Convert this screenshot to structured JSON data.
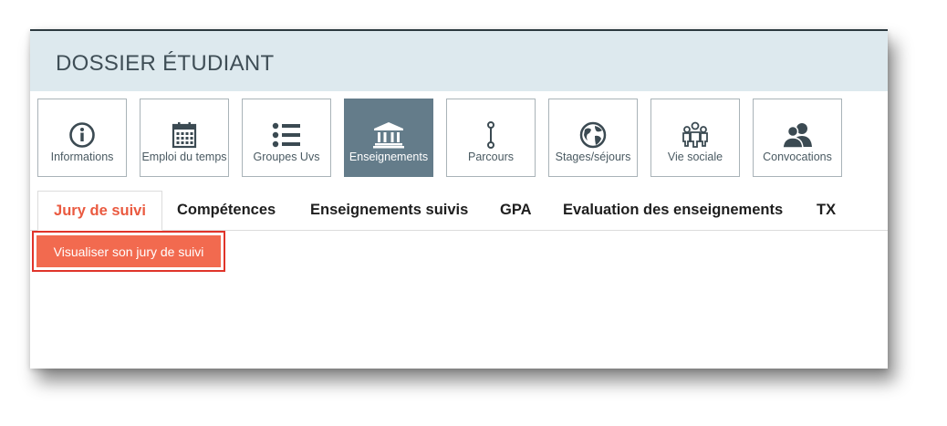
{
  "header": {
    "title": "DOSSIER ÉTUDIANT"
  },
  "tiles": [
    {
      "label": "Informations",
      "icon": "info-circle-icon"
    },
    {
      "label": "Emploi du temps",
      "icon": "calendar-icon"
    },
    {
      "label": "Groupes Uvs",
      "icon": "list-icon"
    },
    {
      "label": "Enseignements",
      "icon": "institution-icon",
      "active": true
    },
    {
      "label": "Parcours",
      "icon": "route-icon"
    },
    {
      "label": "Stages/séjours",
      "icon": "globe-icon"
    },
    {
      "label": "Vie sociale",
      "icon": "people-group-icon"
    },
    {
      "label": "Convocations",
      "icon": "users-icon"
    }
  ],
  "tabs": [
    {
      "label": "Jury de suivi",
      "active": true
    },
    {
      "label": "Compétences"
    },
    {
      "label": "Enseignements suivis"
    },
    {
      "label": "GPA"
    },
    {
      "label": "Evaluation des enseignements"
    },
    {
      "label": "TX"
    }
  ],
  "action": {
    "label": "Visualiser son jury de suivi"
  },
  "colors": {
    "header_bg": "#dde9ee",
    "active_tile": "#647c8a",
    "accent": "#f26a4f",
    "highlight_border": "#e0342a"
  }
}
